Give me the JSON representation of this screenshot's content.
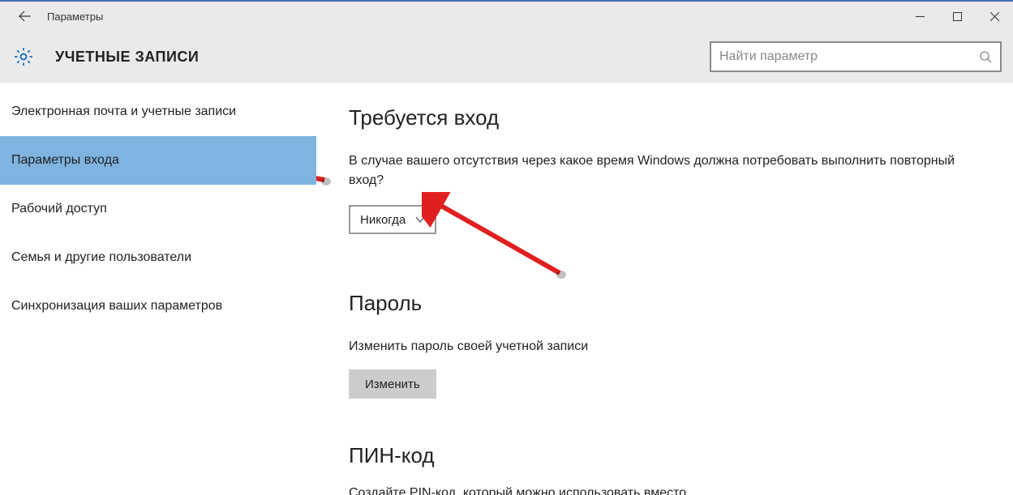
{
  "titlebar": {
    "title": "Параметры"
  },
  "header": {
    "page_title": "УЧЕТНЫЕ ЗАПИСИ"
  },
  "search": {
    "placeholder": "Найти параметр"
  },
  "sidebar": {
    "items": [
      {
        "label": "Электронная почта и учетные записи",
        "selected": false
      },
      {
        "label": "Параметры входа",
        "selected": true
      },
      {
        "label": "Рабочий доступ",
        "selected": false
      },
      {
        "label": "Семья и другие пользователи",
        "selected": false
      },
      {
        "label": "Синхронизация ваших параметров",
        "selected": false
      }
    ]
  },
  "content": {
    "signin": {
      "heading": "Требуется вход",
      "description": "В случае вашего отсутствия через какое время Windows должна потребовать выполнить повторный вход?",
      "dropdown_value": "Никогда"
    },
    "password": {
      "heading": "Пароль",
      "description": "Изменить пароль своей учетной записи",
      "button": "Изменить"
    },
    "pin": {
      "heading": "ПИН-код",
      "cut_text": "Создайте PIN-код, который можно использовать вместо"
    }
  },
  "annotation_color": "#e02020"
}
